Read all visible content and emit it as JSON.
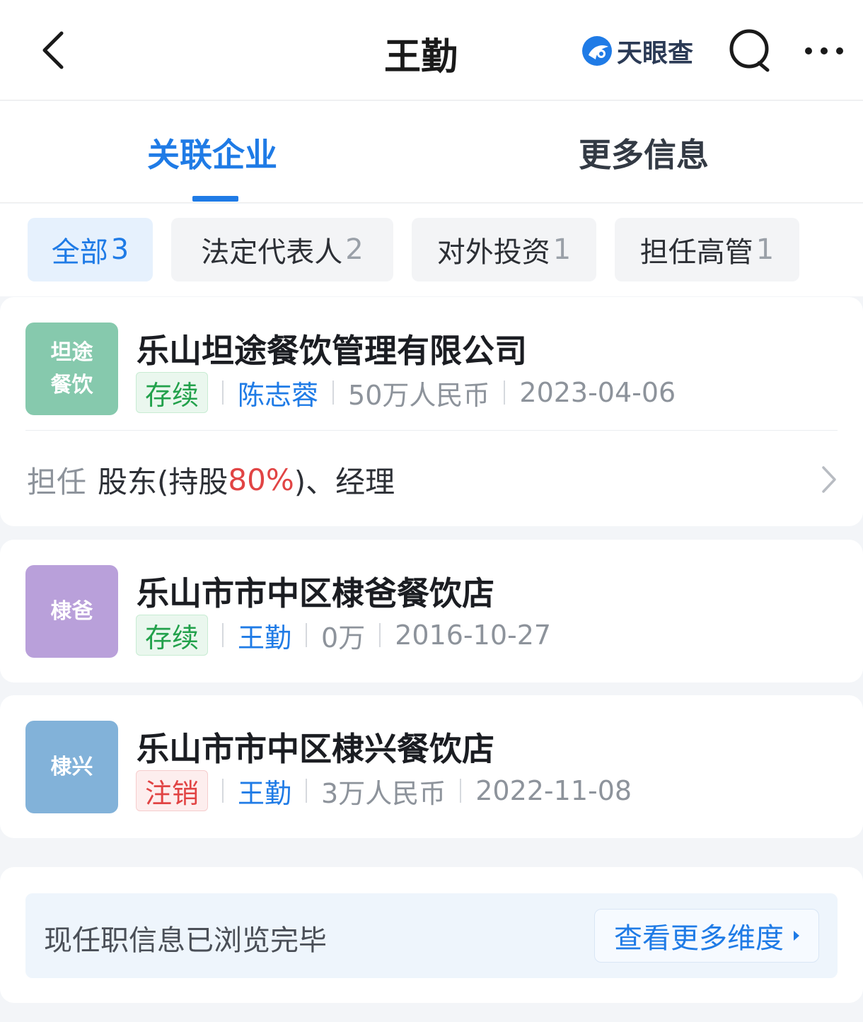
{
  "header": {
    "title": "王勤",
    "brand": "天眼查",
    "brand_color": "#1f7be6"
  },
  "tabs": [
    {
      "label": "关联企业",
      "active": true
    },
    {
      "label": "更多信息",
      "active": false
    }
  ],
  "filters": [
    {
      "label": "全部",
      "count": "3",
      "active": true
    },
    {
      "label": "法定代表人",
      "count": "2",
      "active": false
    },
    {
      "label": "对外投资",
      "count": "1",
      "active": false
    },
    {
      "label": "担任高管",
      "count": "1",
      "active": false
    }
  ],
  "companies": [
    {
      "logo_line1": "坦途",
      "logo_line2": "餐饮",
      "logo_color": "#86c9ad",
      "name": "乐山坦途餐饮管理有限公司",
      "status": "存续",
      "legal_rep": "陈志蓉",
      "capital": "50万人民币",
      "date": "2023-04-06",
      "role_label": "担任",
      "role_pre": "股东(持股",
      "role_pct": "80%",
      "role_post": ")、经理"
    },
    {
      "logo_line1": "棣爸",
      "logo_color": "#b9a0da",
      "name": "乐山市市中区棣爸餐饮店",
      "status": "存续",
      "legal_rep": "王勤",
      "capital": "0万",
      "date": "2016-10-27"
    },
    {
      "logo_line1": "棣兴",
      "logo_color": "#82b2d9",
      "name": "乐山市市中区棣兴餐饮店",
      "status": "注销",
      "legal_rep": "王勤",
      "capital": "3万人民币",
      "date": "2022-11-08"
    }
  ],
  "footer": {
    "end_text": "现任职信息已浏览完毕",
    "more_label": "查看更多维度"
  }
}
